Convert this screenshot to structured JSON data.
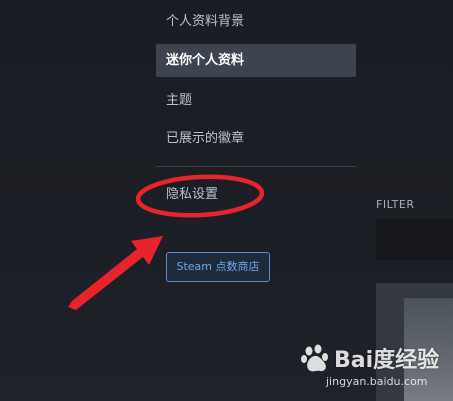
{
  "menu": {
    "items": [
      {
        "label": "个人资料背景",
        "active": false
      },
      {
        "label": "迷你个人资料",
        "active": true
      },
      {
        "label": "主题",
        "active": false
      },
      {
        "label": "已展示的徽章",
        "active": false
      }
    ],
    "privacy_label": "隐私设置"
  },
  "store_button_label": "Steam 点数商店",
  "filter": {
    "label": "FILTER"
  },
  "annotation": {
    "ellipse_color": "#e8232b",
    "arrow_color": "#e8232b"
  },
  "watermark": {
    "brand": "Bai度经验",
    "url": "jingyan.baidu.com"
  },
  "colors": {
    "active_bg": "#3d4450",
    "button_border": "#5a8ad0",
    "button_text": "#6fa6ea"
  }
}
